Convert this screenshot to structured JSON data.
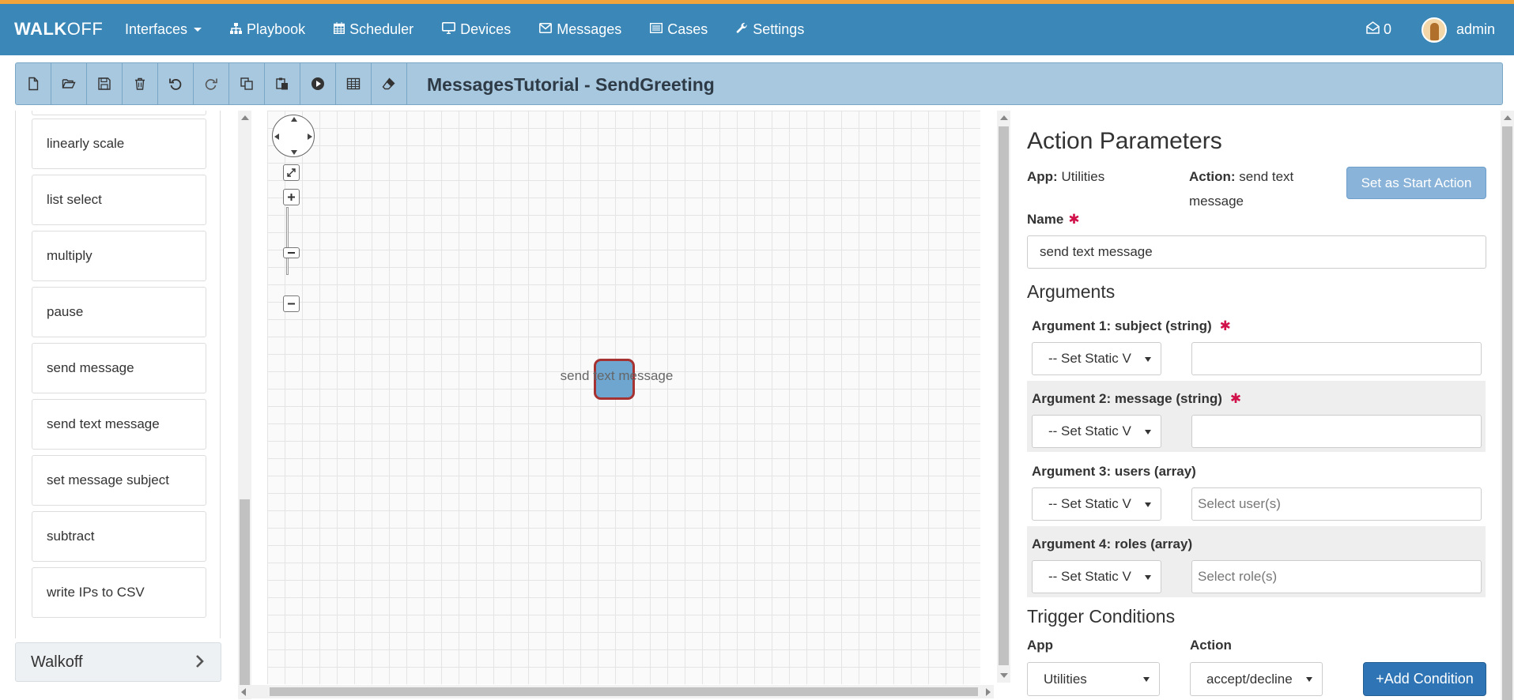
{
  "brand": {
    "bold": "WALK",
    "light": "OFF"
  },
  "nav": {
    "items": [
      {
        "label": "Interfaces",
        "icon": "none",
        "dropdown": true
      },
      {
        "label": "Playbook",
        "icon": "sitemap-icon"
      },
      {
        "label": "Scheduler",
        "icon": "calendar-icon"
      },
      {
        "label": "Devices",
        "icon": "desktop-icon"
      },
      {
        "label": "Messages",
        "icon": "envelope-icon"
      },
      {
        "label": "Cases",
        "icon": "list-alt-icon"
      },
      {
        "label": "Settings",
        "icon": "wrench-icon"
      }
    ],
    "message_count": "0",
    "user": "admin"
  },
  "toolbar": {
    "title": "MessagesTutorial - SendGreeting",
    "buttons": [
      "new-file",
      "open-folder",
      "save",
      "delete",
      "undo",
      "redo",
      "copy",
      "paste",
      "execute",
      "table",
      "eraser"
    ]
  },
  "actions": {
    "items": [
      "linearly scale",
      "list select",
      "multiply",
      "pause",
      "send message",
      "send text message",
      "set message subject",
      "subtract",
      "write IPs to CSV"
    ],
    "group": "Walkoff"
  },
  "canvas": {
    "node_label": "send text message"
  },
  "params": {
    "title": "Action Parameters",
    "app_label": "App:",
    "app_value": "Utilities",
    "action_label": "Action:",
    "action_value_line1": "send text",
    "action_value_line2": "message",
    "start_button": "Set as Start Action",
    "name_label": "Name",
    "required_mark": "✱",
    "name_value": "send text message",
    "arguments_heading": "Arguments",
    "args": [
      {
        "label": "Argument 1: subject (string)",
        "required": true,
        "select": "-- Set Static V",
        "input": "",
        "placeholder": ""
      },
      {
        "label": "Argument 2: message (string)",
        "required": true,
        "select": "-- Set Static V",
        "input": "",
        "placeholder": ""
      },
      {
        "label": "Argument 3: users (array)",
        "required": false,
        "select": "-- Set Static V",
        "input": "",
        "placeholder": "Select user(s)"
      },
      {
        "label": "Argument 4: roles (array)",
        "required": false,
        "select": "-- Set Static V",
        "input": "",
        "placeholder": "Select role(s)"
      }
    ],
    "trigger_heading": "Trigger Conditions",
    "trigger_app_label": "App",
    "trigger_action_label": "Action",
    "trigger_app_value": "Utilities",
    "trigger_action_value": "accept/decline",
    "add_condition": "+Add Condition"
  }
}
